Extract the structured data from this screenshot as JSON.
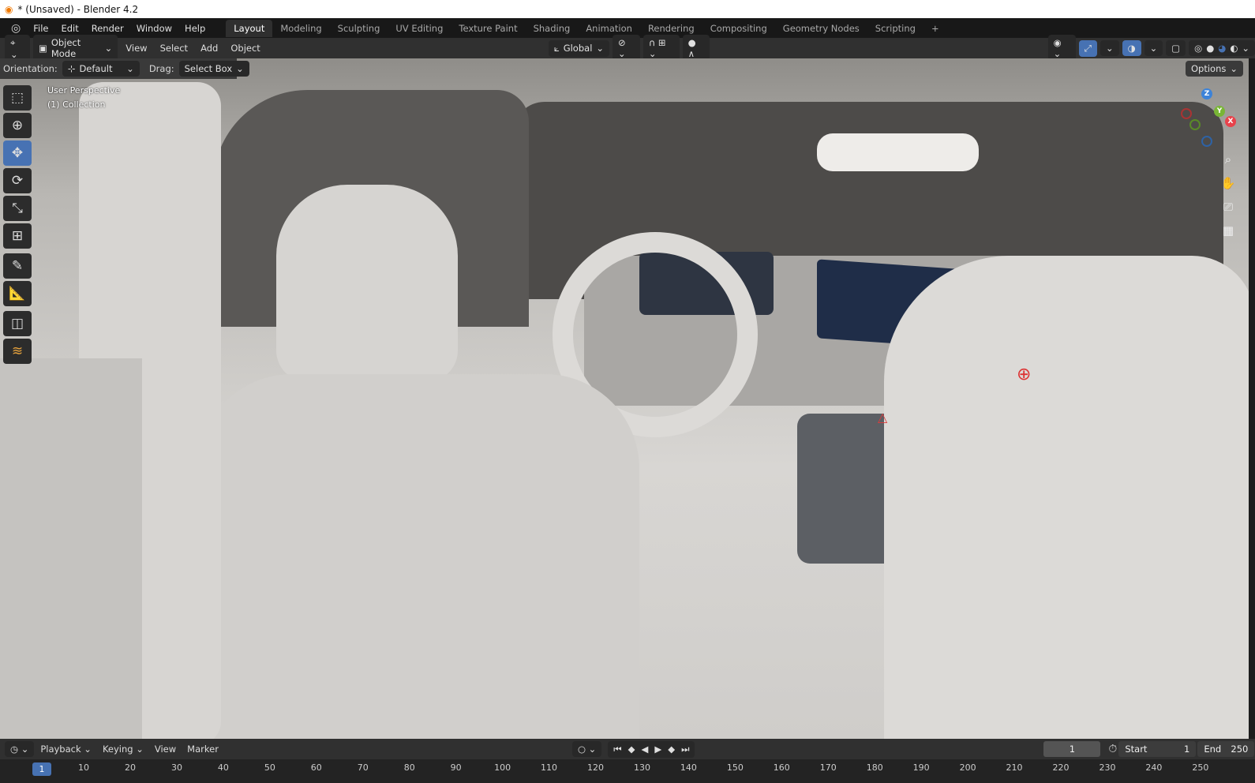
{
  "window_title": "* (Unsaved) - Blender 4.2",
  "menu": [
    "File",
    "Edit",
    "Render",
    "Window",
    "Help"
  ],
  "workspaces": [
    "Layout",
    "Modeling",
    "Sculpting",
    "UV Editing",
    "Texture Paint",
    "Shading",
    "Animation",
    "Rendering",
    "Compositing",
    "Geometry Nodes",
    "Scripting",
    "+"
  ],
  "header": {
    "mode": "Object Mode",
    "menus": [
      "View",
      "Select",
      "Add",
      "Object"
    ],
    "transform_orientation": "Global"
  },
  "toolsettings": {
    "orientation_label": "Orientation:",
    "orientation_value": "Default",
    "drag_label": "Drag:",
    "drag_value": "Select Box",
    "options": "Options"
  },
  "viewport": {
    "perspective": "User Perspective",
    "collection": "(1) Collection"
  },
  "gizmo": {
    "x": "X",
    "y": "Y",
    "z": "Z"
  },
  "timeline": {
    "menus": [
      "Playback",
      "Keying",
      "View",
      "Marker"
    ],
    "current_frame": "1",
    "start_label": "Start",
    "start": "1",
    "end_label": "End",
    "end": "250",
    "ticks": [
      "1",
      "10",
      "20",
      "30",
      "40",
      "50",
      "60",
      "70",
      "80",
      "90",
      "100",
      "110",
      "120",
      "130",
      "140",
      "150",
      "160",
      "170",
      "180",
      "190",
      "200",
      "210",
      "220",
      "230",
      "240",
      "250"
    ]
  },
  "colors": {
    "accent": "#4772b3",
    "x": "#e8424b",
    "y": "#79b636",
    "z": "#3d83d8"
  }
}
